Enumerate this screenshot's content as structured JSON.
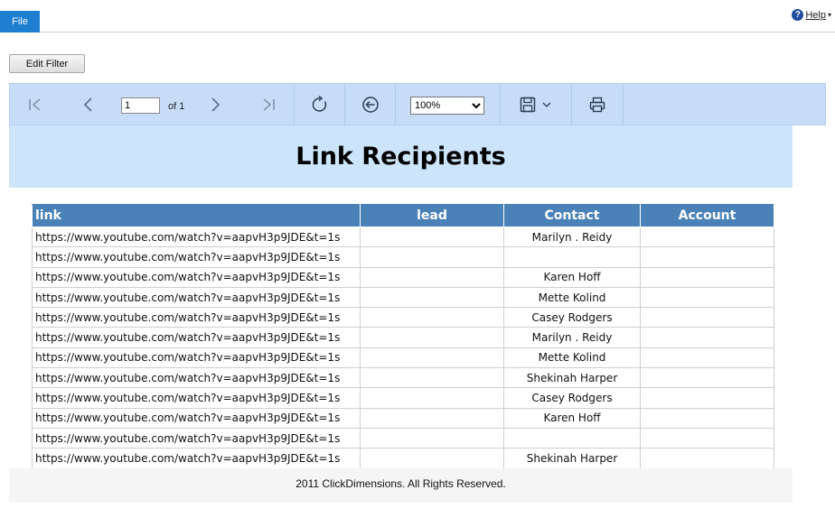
{
  "topbar": {
    "file_label": "File",
    "help_label": "Help",
    "help_icon": "?"
  },
  "filter": {
    "edit_label": "Edit Filter"
  },
  "toolbar": {
    "page_value": "1",
    "of_label": "of 1",
    "zoom_selected": "100%",
    "icons": [
      "first-page-icon",
      "prev-page-icon",
      "next-page-icon",
      "last-page-icon",
      "refresh-icon",
      "back-icon",
      "save-icon",
      "print-icon"
    ]
  },
  "report": {
    "title": "Link Recipients",
    "columns": {
      "link": "link",
      "lead": "lead",
      "contact": "Contact",
      "account": "Account"
    },
    "rows": [
      {
        "link": "https://www.youtube.com/watch?v=aapvH3p9JDE&t=1s",
        "lead": "",
        "contact": "Marilyn . Reidy",
        "account": ""
      },
      {
        "link": "https://www.youtube.com/watch?v=aapvH3p9JDE&t=1s",
        "lead": "",
        "contact": "",
        "account": ""
      },
      {
        "link": "https://www.youtube.com/watch?v=aapvH3p9JDE&t=1s",
        "lead": "",
        "contact": "Karen Hoff",
        "account": ""
      },
      {
        "link": "https://www.youtube.com/watch?v=aapvH3p9JDE&t=1s",
        "lead": "",
        "contact": "Mette Kolind",
        "account": ""
      },
      {
        "link": "https://www.youtube.com/watch?v=aapvH3p9JDE&t=1s",
        "lead": "",
        "contact": "Casey Rodgers",
        "account": ""
      },
      {
        "link": "https://www.youtube.com/watch?v=aapvH3p9JDE&t=1s",
        "lead": "",
        "contact": "Marilyn . Reidy",
        "account": ""
      },
      {
        "link": "https://www.youtube.com/watch?v=aapvH3p9JDE&t=1s",
        "lead": "",
        "contact": "Mette Kolind",
        "account": ""
      },
      {
        "link": "https://www.youtube.com/watch?v=aapvH3p9JDE&t=1s",
        "lead": "",
        "contact": "Shekinah Harper",
        "account": ""
      },
      {
        "link": "https://www.youtube.com/watch?v=aapvH3p9JDE&t=1s",
        "lead": "",
        "contact": "Casey Rodgers",
        "account": ""
      },
      {
        "link": "https://www.youtube.com/watch?v=aapvH3p9JDE&t=1s",
        "lead": "",
        "contact": "Karen Hoff",
        "account": ""
      },
      {
        "link": "https://www.youtube.com/watch?v=aapvH3p9JDE&t=1s",
        "lead": "",
        "contact": "",
        "account": ""
      },
      {
        "link": "https://www.youtube.com/watch?v=aapvH3p9JDE&t=1s",
        "lead": "",
        "contact": "Shekinah Harper",
        "account": ""
      }
    ],
    "footer": "2011 ClickDimensions. All Rights Reserved."
  },
  "colors": {
    "accent": "#1e7fd0",
    "toolbar_bg": "#c7dcf7",
    "title_band": "#cde5fb",
    "header_bg": "#4a82b8"
  }
}
